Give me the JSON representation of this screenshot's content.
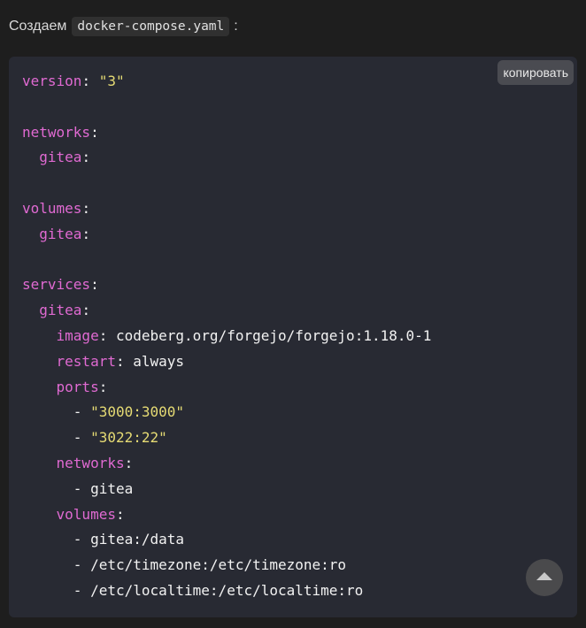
{
  "intro": {
    "text": "Создаем",
    "filename": "docker-compose.yaml",
    "suffix": ":"
  },
  "code_block": {
    "copy_label": "копировать",
    "lines": [
      [
        {
          "t": "k",
          "v": "version"
        },
        {
          "t": "p",
          "v": ": "
        },
        {
          "t": "s",
          "v": "\"3\""
        }
      ],
      [],
      [
        {
          "t": "k",
          "v": "networks"
        },
        {
          "t": "p",
          "v": ":"
        }
      ],
      [
        {
          "t": "p",
          "v": "  "
        },
        {
          "t": "k",
          "v": "gitea"
        },
        {
          "t": "p",
          "v": ":"
        }
      ],
      [],
      [
        {
          "t": "k",
          "v": "volumes"
        },
        {
          "t": "p",
          "v": ":"
        }
      ],
      [
        {
          "t": "p",
          "v": "  "
        },
        {
          "t": "k",
          "v": "gitea"
        },
        {
          "t": "p",
          "v": ":"
        }
      ],
      [],
      [
        {
          "t": "k",
          "v": "services"
        },
        {
          "t": "p",
          "v": ":"
        }
      ],
      [
        {
          "t": "p",
          "v": "  "
        },
        {
          "t": "k",
          "v": "gitea"
        },
        {
          "t": "p",
          "v": ":"
        }
      ],
      [
        {
          "t": "p",
          "v": "    "
        },
        {
          "t": "k",
          "v": "image"
        },
        {
          "t": "p",
          "v": ": "
        },
        {
          "t": "v",
          "v": "codeberg.org/forgejo/forgejo:1.18.0-1"
        }
      ],
      [
        {
          "t": "p",
          "v": "    "
        },
        {
          "t": "k",
          "v": "restart"
        },
        {
          "t": "p",
          "v": ": "
        },
        {
          "t": "v",
          "v": "always"
        }
      ],
      [
        {
          "t": "p",
          "v": "    "
        },
        {
          "t": "k",
          "v": "ports"
        },
        {
          "t": "p",
          "v": ":"
        }
      ],
      [
        {
          "t": "p",
          "v": "      - "
        },
        {
          "t": "s",
          "v": "\"3000:3000\""
        }
      ],
      [
        {
          "t": "p",
          "v": "      - "
        },
        {
          "t": "s",
          "v": "\"3022:22\""
        }
      ],
      [
        {
          "t": "p",
          "v": "    "
        },
        {
          "t": "k",
          "v": "networks"
        },
        {
          "t": "p",
          "v": ":"
        }
      ],
      [
        {
          "t": "p",
          "v": "      - "
        },
        {
          "t": "v",
          "v": "gitea"
        }
      ],
      [
        {
          "t": "p",
          "v": "    "
        },
        {
          "t": "k",
          "v": "volumes"
        },
        {
          "t": "p",
          "v": ":"
        }
      ],
      [
        {
          "t": "p",
          "v": "      - "
        },
        {
          "t": "v",
          "v": "gitea:/data"
        }
      ],
      [
        {
          "t": "p",
          "v": "      - "
        },
        {
          "t": "v",
          "v": "/etc/timezone:/etc/timezone:ro"
        }
      ],
      [
        {
          "t": "p",
          "v": "      - "
        },
        {
          "t": "v",
          "v": "/etc/localtime:/etc/localtime:ro"
        }
      ]
    ]
  },
  "scroll_top": {
    "icon": "arrow-up-icon"
  },
  "colors": {
    "page_background": "#1e1e1e",
    "code_background": "#282a33",
    "key": "#e06ad2",
    "string": "#e6db74",
    "plain": "#f2f2f2"
  }
}
